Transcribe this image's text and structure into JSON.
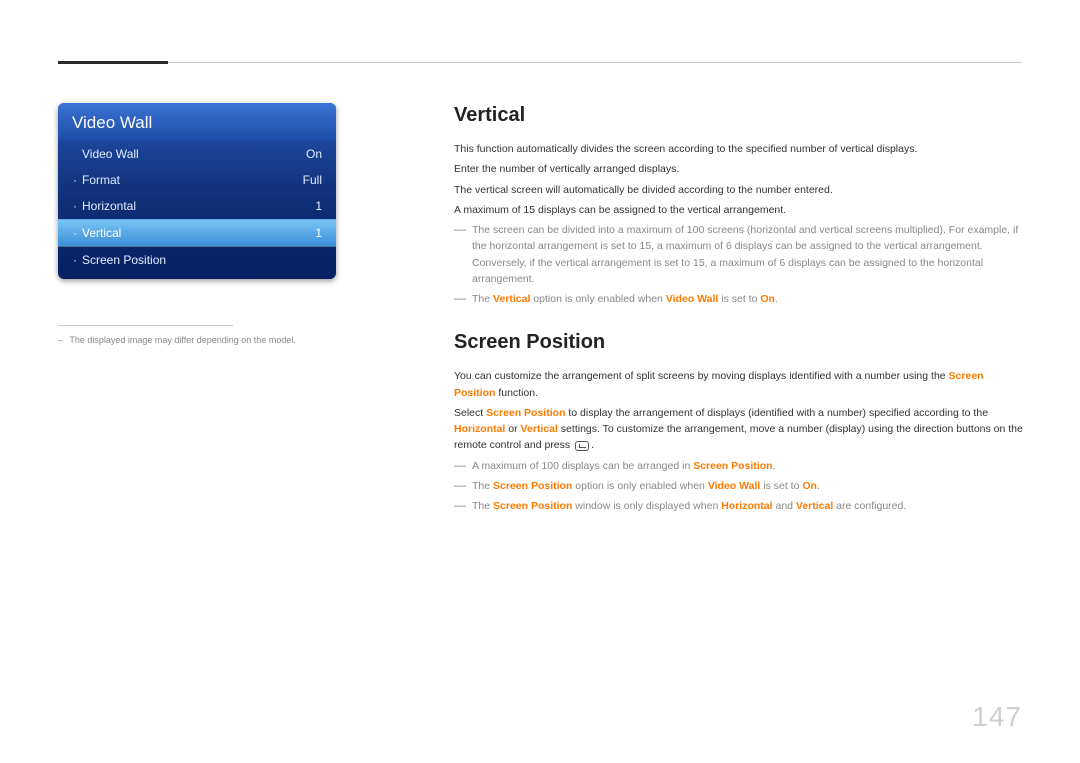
{
  "page_number": "147",
  "osd": {
    "title": "Video Wall",
    "items": [
      {
        "label": "Video Wall",
        "value": "On",
        "bullet": "",
        "selected": false
      },
      {
        "label": "Format",
        "value": "Full",
        "bullet": "·",
        "selected": false
      },
      {
        "label": "Horizontal",
        "value": "1",
        "bullet": "·",
        "selected": false
      },
      {
        "label": "Vertical",
        "value": "1",
        "bullet": "·",
        "selected": true
      },
      {
        "label": "Screen Position",
        "value": "",
        "bullet": "·",
        "selected": false
      }
    ],
    "footnote": "The displayed image may differ depending on the model."
  },
  "sections": {
    "vertical": {
      "heading": "Vertical",
      "p1": "This function automatically divides the screen according to the specified number of vertical displays.",
      "p2": "Enter the number of vertically arranged displays.",
      "p3": "The vertical screen will automatically be divided according to the number entered.",
      "p4": "A maximum of 15 displays can be assigned to the vertical arrangement.",
      "note1": "The screen can be divided into a maximum of 100 screens (horizontal and vertical screens multiplied). For example, if the horizontal arrangement is set to 15, a maximum of 6 displays can be assigned to the vertical arrangement. Conversely, if the vertical arrangement is set to 15, a maximum of 6 displays can be assigned to the horizontal arrangement.",
      "note2_pre": "The ",
      "note2_kw1": "Vertical",
      "note2_mid": " option is only enabled when ",
      "note2_kw2": "Video Wall",
      "note2_mid2": " is set to ",
      "note2_kw3": "On",
      "note2_end": "."
    },
    "screen_position": {
      "heading": "Screen Position",
      "p1_pre": "You can customize the arrangement of split screens by moving displays identified with a number using the ",
      "p1_kw": "Screen Position",
      "p1_end": " function.",
      "p2_pre": "Select ",
      "p2_kw1": "Screen Position",
      "p2_mid1": " to display the arrangement of displays (identified with a number) specified according to the ",
      "p2_kw2": "Horizontal",
      "p2_mid2": " or ",
      "p2_kw3": "Vertical",
      "p2_end": " settings. To customize the arrangement, move a number (display) using the direction buttons on the remote control and press ",
      "note1_pre": "A maximum of 100 displays can be arranged in ",
      "note1_kw": "Screen Position",
      "note1_end": ".",
      "note2_pre": "The ",
      "note2_kw1": "Screen Position",
      "note2_mid": " option is only enabled when ",
      "note2_kw2": "Video Wall",
      "note2_mid2": " is set to ",
      "note2_kw3": "On",
      "note2_end": ".",
      "note3_pre": "The ",
      "note3_kw1": "Screen Position",
      "note3_mid": " window is only displayed when ",
      "note3_kw2": "Horizontal",
      "note3_mid2": " and ",
      "note3_kw3": "Vertical",
      "note3_end": " are configured."
    }
  }
}
